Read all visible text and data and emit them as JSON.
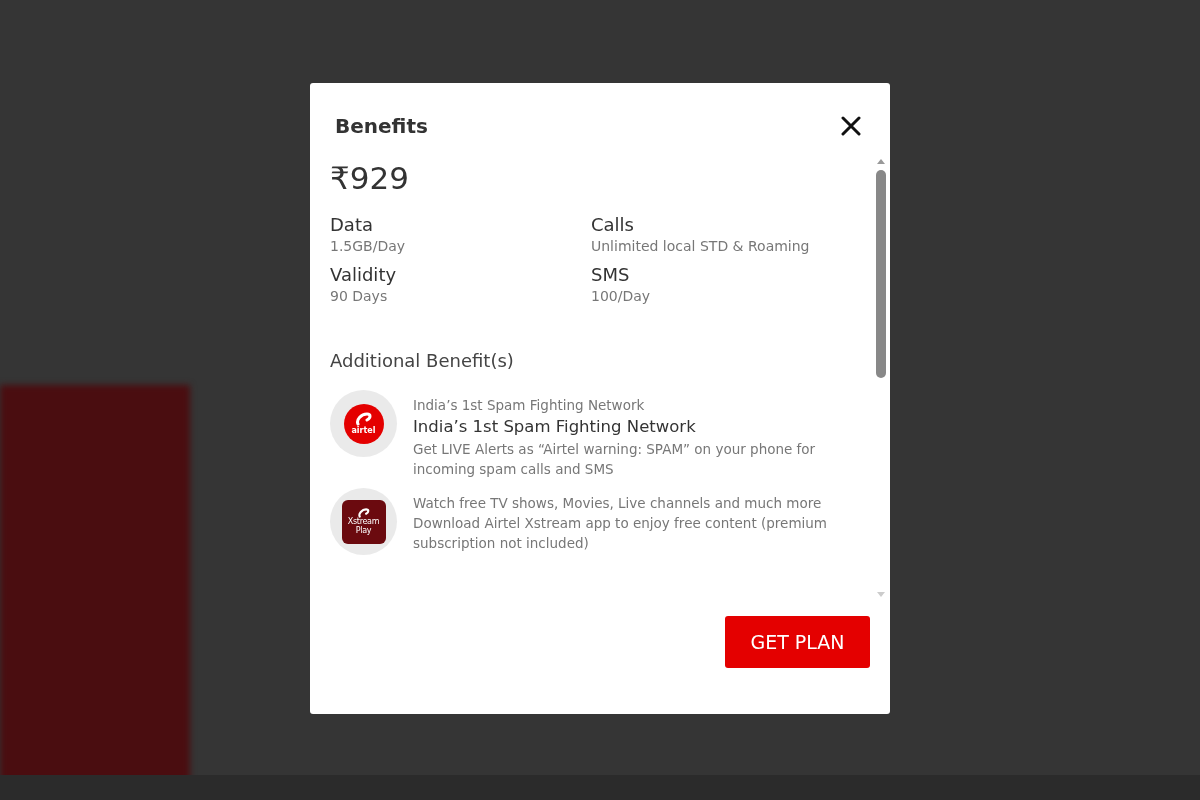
{
  "dialog": {
    "title": "Benefits",
    "price": "₹929",
    "details": [
      {
        "label": "Data",
        "value": "1.5GB/Day"
      },
      {
        "label": "Calls",
        "value": "Unlimited local STD & Roaming"
      },
      {
        "label": "Validity",
        "value": "90 Days"
      },
      {
        "label": "SMS",
        "value": "100/Day"
      }
    ],
    "additional_heading": "Additional Benefit(s)",
    "benefits": [
      {
        "kind": "airtel",
        "logo_text": "airtel",
        "caption": "India’s 1st Spam Fighting Network",
        "title": "India’s 1st Spam Fighting Network",
        "description": "Get LIVE Alerts as “Airtel warning: SPAM” on your phone for incoming spam calls and SMS"
      },
      {
        "kind": "xstream",
        "logo_text": "Xstream Play",
        "caption": "Watch free TV shows, Movies, Live channels and much more",
        "description": "Download Airtel Xstream app to enjoy free content (premium subscription not included)"
      }
    ],
    "button": "GET PLAN"
  }
}
